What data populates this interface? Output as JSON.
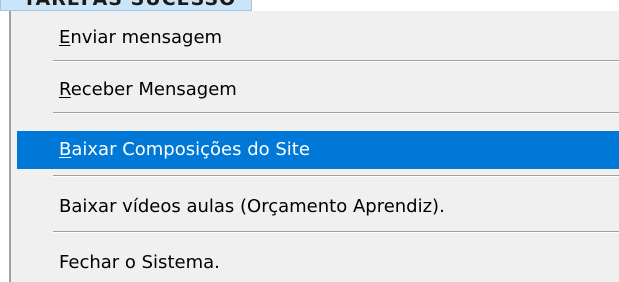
{
  "menu_tab": {
    "label": "TAREFAS SUCESSO"
  },
  "menu": {
    "items": [
      {
        "mnemonic": "E",
        "rest": "nviar mensagem",
        "highlighted": false
      },
      {
        "mnemonic": "R",
        "rest": "eceber Mensagem",
        "highlighted": false
      },
      {
        "mnemonic": "B",
        "rest": "aixar Composições do Site",
        "highlighted": true
      },
      {
        "mnemonic": "",
        "rest": "Baixar vídeos aulas (Orçamento Aprendiz).",
        "highlighted": false
      },
      {
        "mnemonic": "",
        "rest": "Fechar o Sistema.",
        "highlighted": false
      }
    ]
  },
  "colors": {
    "highlight": "#0078d7",
    "menu_background": "#f0f0f0",
    "menu_tab_background": "#cce4f7"
  }
}
